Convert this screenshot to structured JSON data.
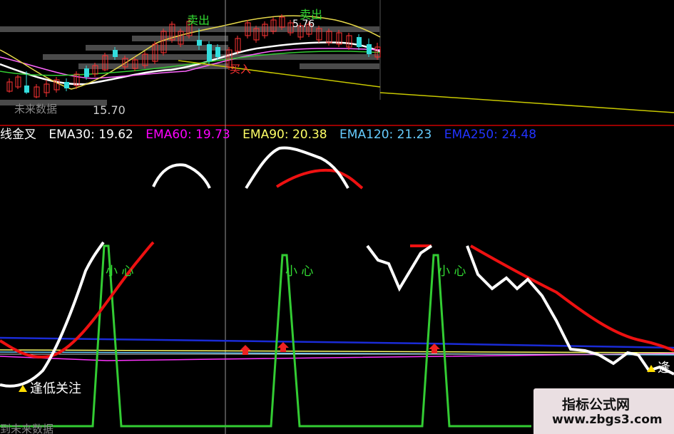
{
  "upper_panel": {
    "signals": {
      "sell": "卖出",
      "buy": "买入",
      "price_label": "76",
      "price_top": "5.76"
    },
    "bottom_texts": {
      "left": "未来数据",
      "price": "15.70"
    }
  },
  "indicator_header": {
    "name": "线金叉",
    "items": [
      {
        "label": "EMA30: 19.62",
        "color": "#ffffff"
      },
      {
        "label": "EMA60: 19.73",
        "color": "#ff00ff"
      },
      {
        "label": "EMA90: 20.38",
        "color": "#ffff66"
      },
      {
        "label": "EMA120: 21.23",
        "color": "#66ccff"
      },
      {
        "label": "EMA250: 24.48",
        "color": "#2233ff"
      }
    ]
  },
  "lower_panel": {
    "caution_labels": [
      "小 心",
      "小 心",
      "小 心"
    ],
    "low_watch": "逢低关注",
    "right_partial": "逢",
    "future_data": "到未来数据"
  },
  "watermark": {
    "title": "指标公式网",
    "url": "www.zbgs3.com"
  },
  "colors": {
    "green": "#33cc33",
    "red": "#ee1111",
    "white": "#ffffff",
    "yellow": "#ffff00",
    "blue": "#1a2bd6",
    "magenta": "#ff33ff",
    "gray": "#4a4a4a"
  }
}
